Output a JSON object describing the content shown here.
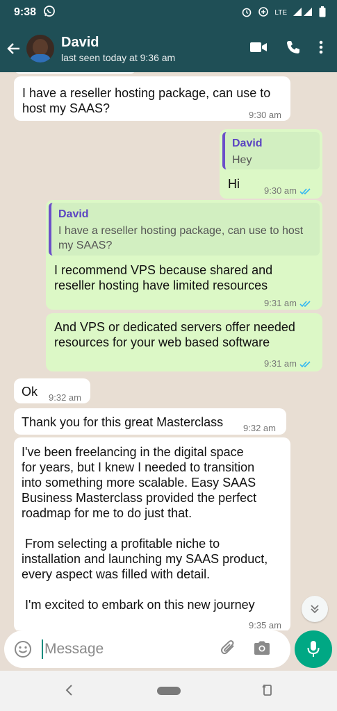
{
  "status_bar": {
    "time": "9:38",
    "network": "LTE"
  },
  "header": {
    "name": "David",
    "last_seen": "last seen today at 9:36 am"
  },
  "messages": [
    {
      "dir": "in",
      "text_line1": "I have a reseller hosting package, can use to",
      "text_line2": "host my SAAS?",
      "time": "9:30 am"
    },
    {
      "dir": "out",
      "quote_name": "David",
      "quote_text": "Hey",
      "text": "Hi",
      "time": "9:30 am"
    },
    {
      "dir": "out",
      "quote_name": "David",
      "quote_line1": "I have a reseller hosting package, can use to host",
      "quote_line2": "my SAAS?",
      "text_line1": "I recommend VPS because shared and",
      "text_line2": "reseller hosting have limited resources",
      "time": "9:31 am"
    },
    {
      "dir": "out",
      "text_line1": "And VPS or dedicated servers offer needed",
      "text_line2": "resources for your web based software",
      "time": "9:31 am"
    },
    {
      "dir": "in",
      "text": "Ok",
      "time": "9:32 am"
    },
    {
      "dir": "in",
      "text": "Thank you for this great Masterclass",
      "time": "9:32 am"
    },
    {
      "dir": "in",
      "lines": [
        "I've been freelancing in the digital space",
        "for years, but I knew I needed to transition",
        "into something more scalable. Easy SAAS",
        "Business Masterclass provided the perfect",
        "roadmap for me to do just that.",
        "From selecting a profitable niche to",
        "installation and launching my SAAS product,",
        "every aspect was filled with detail.",
        "I'm excited to embark on this new journey"
      ],
      "time": "9:35 am"
    }
  ],
  "composer": {
    "placeholder": "Message"
  },
  "colors": {
    "header": "#1f4f56",
    "outgoing": "#dcf8c6",
    "incoming": "#ffffff",
    "accent": "#00a884",
    "ticks": "#34b7f1"
  },
  "icons": [
    "whatsapp-icon",
    "alarm-icon",
    "data-saver-icon",
    "signal-icon",
    "battery-icon",
    "back-arrow-icon",
    "video-call-icon",
    "phone-icon",
    "more-vert-icon",
    "double-check-icon",
    "chevrons-down-icon",
    "emoji-icon",
    "attach-icon",
    "camera-icon",
    "mic-icon"
  ]
}
